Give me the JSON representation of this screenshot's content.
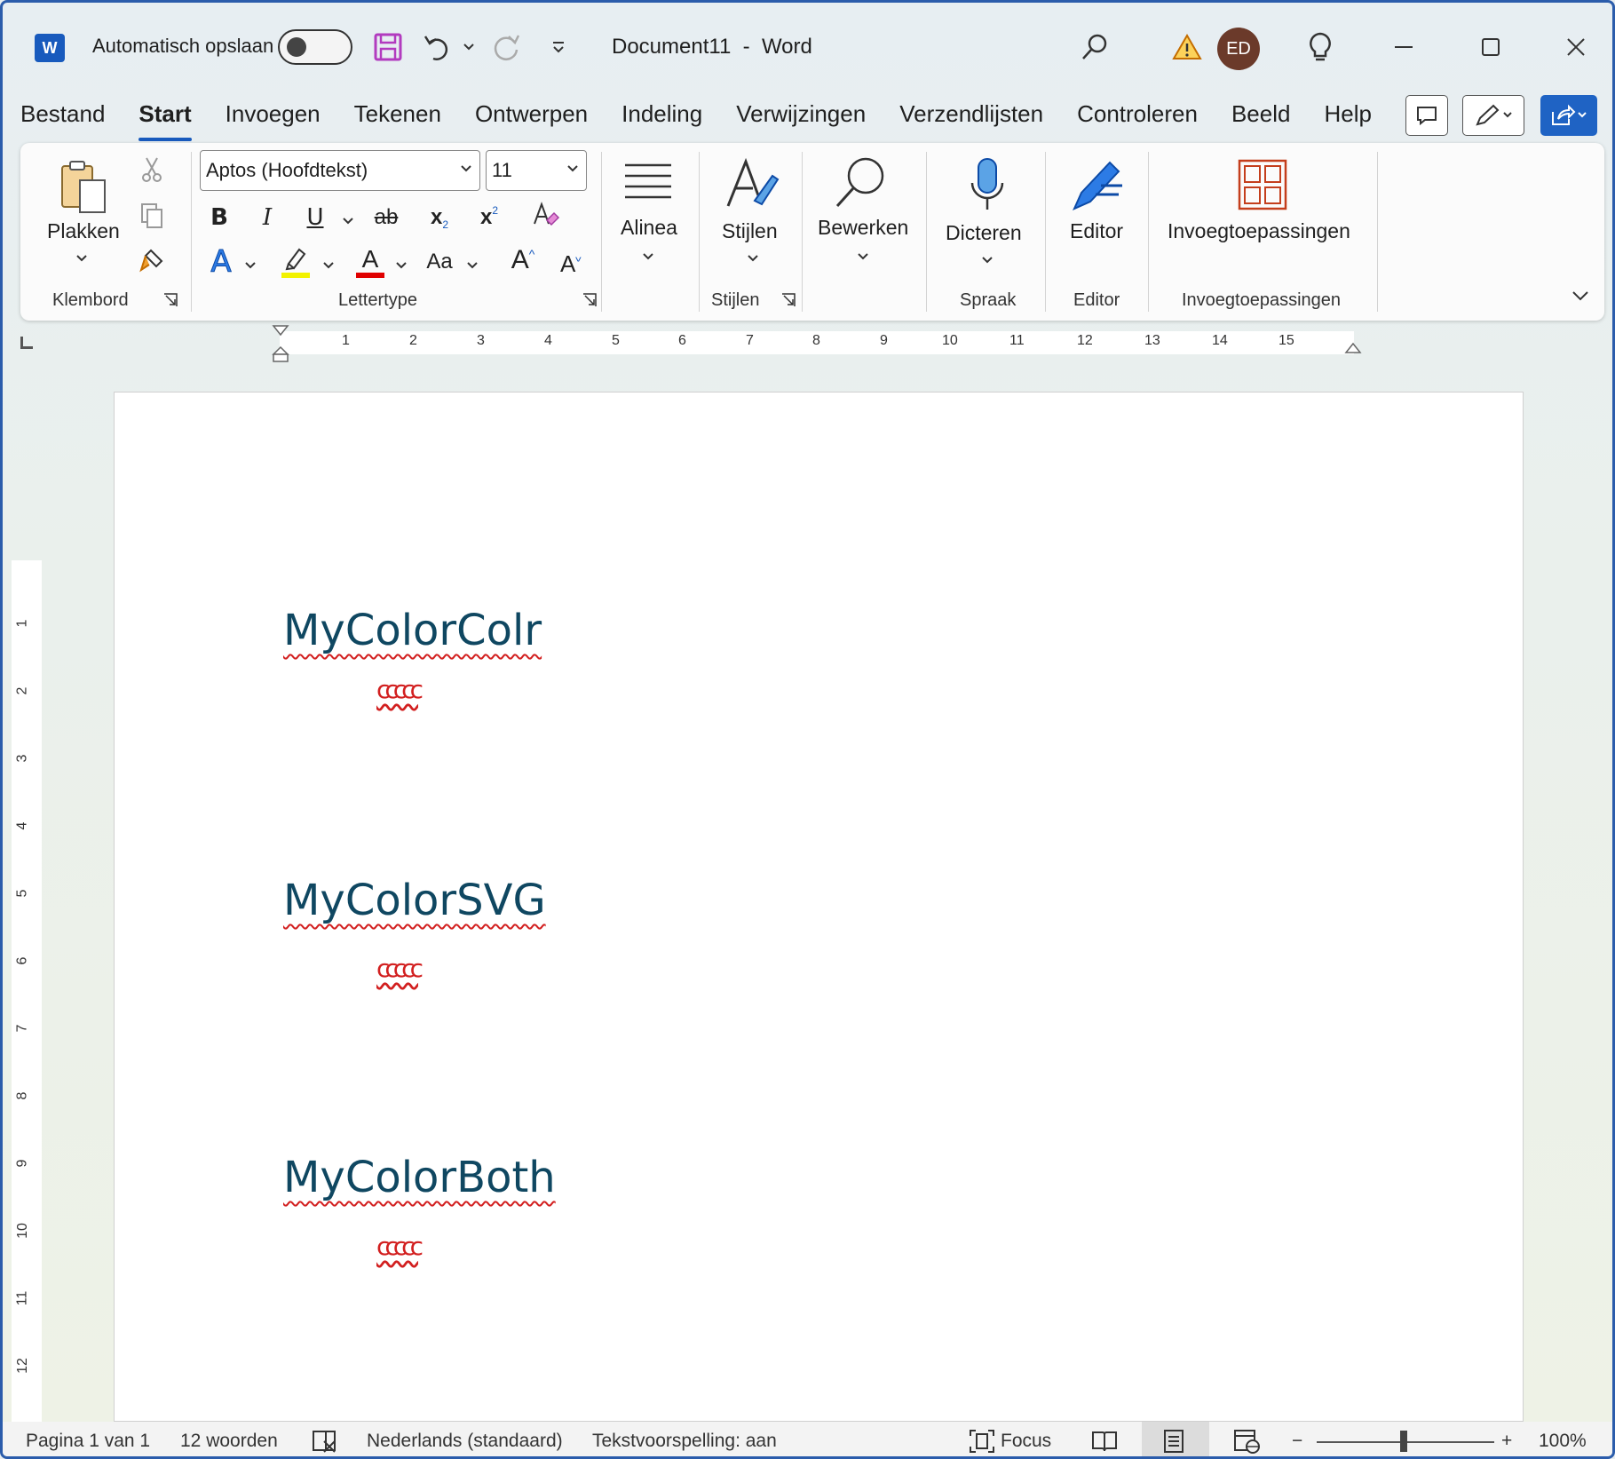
{
  "titlebar": {
    "autosave_label": "Automatisch opslaan",
    "document_title": "Document11  -  Word",
    "avatar_initials": "ED",
    "app_logo": "W"
  },
  "menu": {
    "tabs": [
      "Bestand",
      "Start",
      "Invoegen",
      "Tekenen",
      "Ontwerpen",
      "Indeling",
      "Verwijzingen",
      "Verzendlijsten",
      "Controleren",
      "Beeld",
      "Help"
    ],
    "active_tab": "Start"
  },
  "ribbon": {
    "clipboard": {
      "paste_label": "Plakken",
      "group_label": "Klembord"
    },
    "font": {
      "font_name": "Aptos (Hoofdtekst)",
      "font_size": "11",
      "group_label": "Lettertype",
      "bold": "B",
      "italic": "I",
      "underline": "U",
      "strikethrough": "ab",
      "subscript": "x",
      "subscript_mark": "2",
      "superscript": "x",
      "superscript_mark": "2",
      "text_effects": "A",
      "font_color": "A",
      "change_case": "Aa",
      "grow_font": "A",
      "shrink_font": "A"
    },
    "paragraph": {
      "label": "Alinea"
    },
    "styles": {
      "label": "Stijlen",
      "group_label": "Stijlen"
    },
    "editing": {
      "label": "Bewerken"
    },
    "voice": {
      "label": "Dicteren",
      "group_label": "Spraak"
    },
    "editor": {
      "label": "Editor",
      "group_label": "Editor"
    },
    "addins": {
      "label": "Invoegtoepassingen",
      "group_label": "Invoegtoepassingen"
    }
  },
  "ruler": {
    "h_numbers": [
      "1",
      "2",
      "3",
      "4",
      "5",
      "6",
      "7",
      "8",
      "9",
      "10",
      "11",
      "12",
      "13",
      "14",
      "15"
    ],
    "v_numbers": [
      "1",
      "2",
      "3",
      "4",
      "5",
      "6",
      "7",
      "8",
      "9",
      "10",
      "11",
      "12"
    ]
  },
  "document": {
    "blocks": [
      {
        "heading": "MyColorColr",
        "glyphs": "ccccc"
      },
      {
        "heading": "MyColorSVG",
        "glyphs": "ccccc"
      },
      {
        "heading": "MyColorBoth",
        "glyphs": "ccccc"
      }
    ]
  },
  "statusbar": {
    "page": "Pagina 1 van 1",
    "words": "12 woorden",
    "language": "Nederlands (standaard)",
    "predictions": "Tekstvoorspelling: aan",
    "focus": "Focus",
    "zoom_minus": "−",
    "zoom_plus": "+",
    "zoom": "100%"
  },
  "colors": {
    "accent": "#185abd",
    "heading": "#0f4761",
    "spelling": "#d21f1f",
    "addins_icon": "#c43e1c"
  },
  "icons": {
    "titlebar": [
      "word-logo-icon",
      "save-icon",
      "undo-icon",
      "undo-dropdown-icon",
      "redo-icon",
      "customize-qat-icon",
      "search-icon",
      "warning-icon",
      "lightbulb-icon",
      "minimize-icon",
      "maximize-icon",
      "close-icon"
    ],
    "ribbon": [
      "paste-icon",
      "cut-icon",
      "copy-icon",
      "format-painter-icon",
      "clear-formatting-icon",
      "highlight-icon",
      "paragraph-icon",
      "styles-icon",
      "find-icon",
      "microphone-icon",
      "editor-pen-icon",
      "addins-grid-icon",
      "collapse-ribbon-icon"
    ]
  }
}
